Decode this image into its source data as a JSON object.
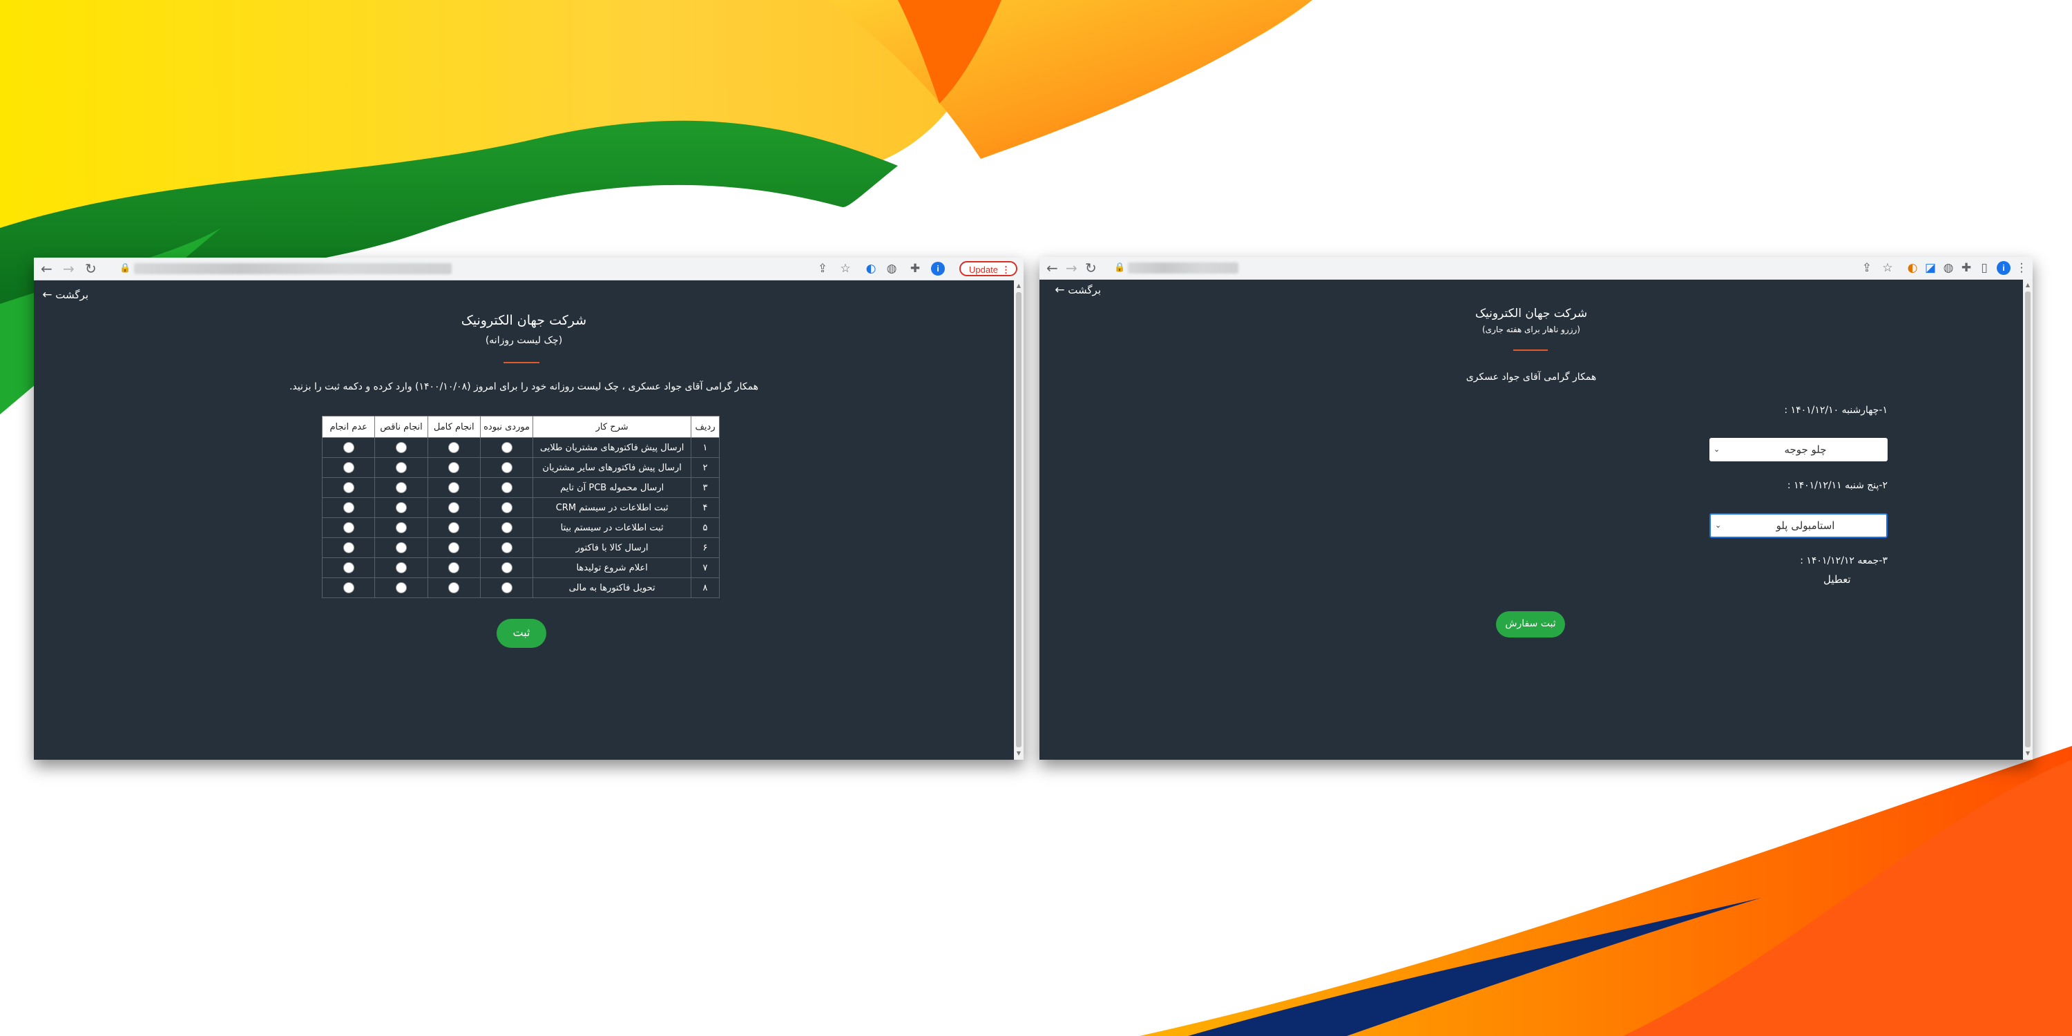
{
  "colors": {
    "page_bg": "#25303a",
    "accent_divider": "#e05a2b",
    "submit_green": "#28a745",
    "update_red": "#d93025"
  },
  "left_window": {
    "toolbar": {
      "update_label": "Update",
      "profile_letter": "i",
      "icons": [
        "back-icon",
        "forward-icon",
        "reload-icon",
        "lock-icon",
        "share-icon",
        "star-icon",
        "extension-icon",
        "puzzle-icon",
        "menu-icon"
      ]
    },
    "back_label": "برگشت",
    "company": "شرکت جهان الکترونیک",
    "subtitle": "(چک لیست روزانه)",
    "greeting": "همکار گرامی آقای جواد عسکری ، چک لیست روزانه خود را برای امروز (۱۴۰۰/۱۰/۰۸) وارد کرده و دکمه ثبت را بزنید.",
    "table": {
      "headers": [
        "ردیف",
        "شرح کار",
        "موردی نبوده",
        "انجام کامل",
        "انجام ناقص",
        "عدم انجام"
      ],
      "rows": [
        {
          "num": "۱",
          "desc": "ارسال پیش فاکتورهای مشتریان طلایی"
        },
        {
          "num": "۲",
          "desc": "ارسال پیش فاکتورهای سایر مشتریان"
        },
        {
          "num": "۳",
          "desc": "ارسال محموله PCB آن تایم"
        },
        {
          "num": "۴",
          "desc": "ثبت اطلاعات در سیستم CRM"
        },
        {
          "num": "۵",
          "desc": "ثبت اطلاعات در سیستم بیتا"
        },
        {
          "num": "۶",
          "desc": "ارسال کالا با فاکتور"
        },
        {
          "num": "۷",
          "desc": "اعلام شروع تولیدها"
        },
        {
          "num": "۸",
          "desc": "تحویل فاکتورها به مالی"
        }
      ]
    },
    "submit_label": "ثبت"
  },
  "right_window": {
    "back_label": "برگشت",
    "company": "شرکت جهان الکترونیک",
    "subtitle": "(رزرو ناهار برای هفته جاری)",
    "greeting": "همکار گرامی آقای جواد عسکری",
    "days": [
      {
        "label": "۱-چهارشنبه ۱۴۰۱/۱۲/۱۰ :",
        "selected": "چلو جوجه"
      },
      {
        "label": "۲-پنج شنبه ۱۴۰۱/۱۲/۱۱ :",
        "selected": "استامبولی پلو"
      },
      {
        "label": "۳-جمعه ۱۴۰۱/۱۲/۱۲ :",
        "holiday": "تعطیل"
      }
    ],
    "submit_label": "ثبت سفارش"
  }
}
